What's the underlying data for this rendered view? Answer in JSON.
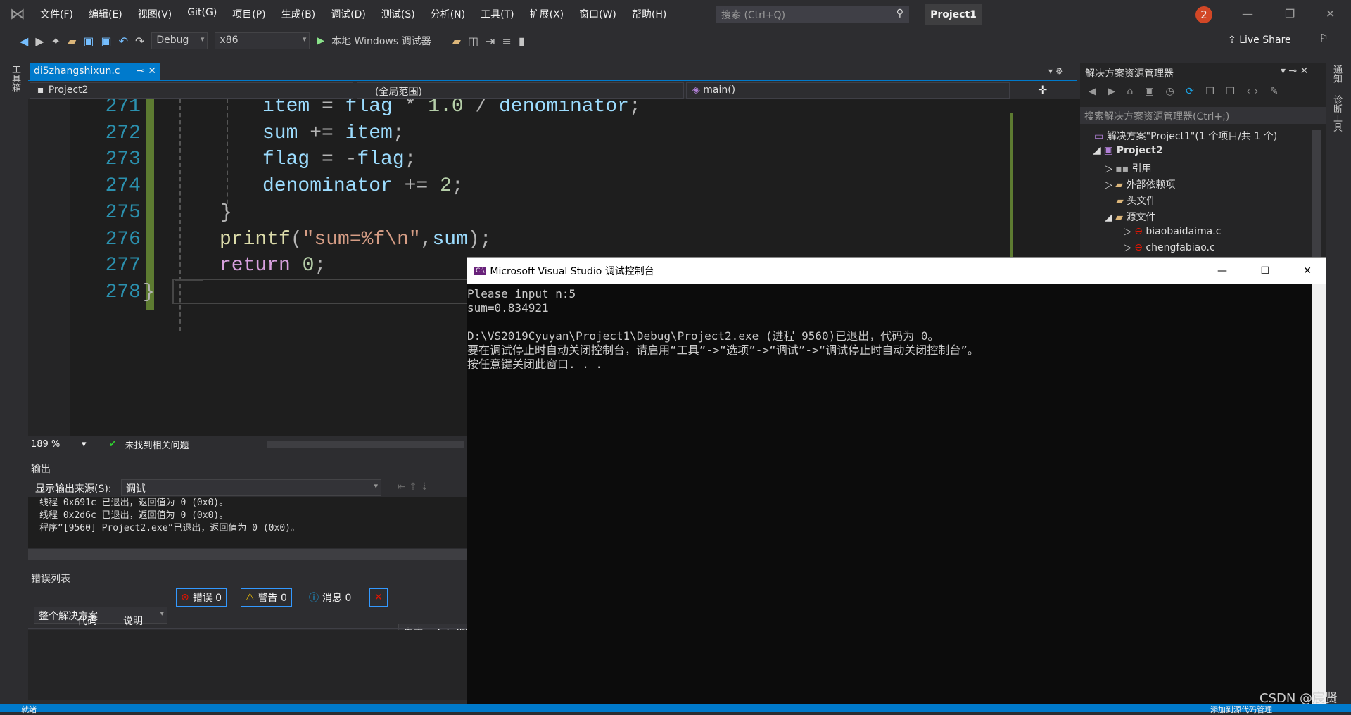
{
  "menu": {
    "items": [
      "文件(F)",
      "编辑(E)",
      "视图(V)",
      "Git(G)",
      "项目(P)",
      "生成(B)",
      "调试(D)",
      "测试(S)",
      "分析(N)",
      "工具(T)",
      "扩展(X)",
      "窗口(W)",
      "帮助(H)"
    ],
    "search_placeholder": "搜索 (Ctrl+Q)",
    "project": "Project1",
    "notifications": "2"
  },
  "toolbar": {
    "config": "Debug",
    "platform": "x86",
    "run": "本地 Windows 调试器",
    "live_share": "Live Share"
  },
  "left_strip": "工具箱",
  "right_strip": [
    "通知",
    "诊断工具"
  ],
  "editor": {
    "tab": "di5zhangshixun.c",
    "project_combo": "Project2",
    "scope_combo": "(全局范围)",
    "func_combo": "main()",
    "zoom": "189 %",
    "issues": "未找到相关问题",
    "lines": [
      {
        "n": "271",
        "tokens": [
          [
            "id",
            "item"
          ],
          [
            "op",
            " = "
          ],
          [
            "id",
            "flag"
          ],
          [
            "op",
            " * "
          ],
          [
            "num",
            "1.0"
          ],
          [
            "op",
            " / "
          ],
          [
            "id",
            "denominator"
          ],
          [
            "op",
            ";"
          ]
        ]
      },
      {
        "n": "272",
        "tokens": [
          [
            "id",
            "sum"
          ],
          [
            "op",
            " += "
          ],
          [
            "id",
            "item"
          ],
          [
            "op",
            ";"
          ]
        ]
      },
      {
        "n": "273",
        "tokens": [
          [
            "id",
            "flag"
          ],
          [
            "op",
            " = -"
          ],
          [
            "id",
            "flag"
          ],
          [
            "op",
            ";"
          ]
        ]
      },
      {
        "n": "274",
        "tokens": [
          [
            "id",
            "denominator"
          ],
          [
            "op",
            " += "
          ],
          [
            "num",
            "2"
          ],
          [
            "op",
            ";"
          ]
        ]
      },
      {
        "n": "275",
        "tokens": [
          [
            "op",
            "}"
          ]
        ]
      },
      {
        "n": "276",
        "tokens": [
          [
            "fn",
            "printf"
          ],
          [
            "op",
            "("
          ],
          [
            "str",
            "\"sum=%f\\n\""
          ],
          [
            "op",
            ","
          ],
          [
            "id",
            "sum"
          ],
          [
            "op",
            ");"
          ]
        ]
      },
      {
        "n": "277",
        "tokens": [
          [
            "kw",
            "return"
          ],
          [
            "op",
            " "
          ],
          [
            "num",
            "0"
          ],
          [
            "op",
            ";"
          ]
        ]
      },
      {
        "n": "278",
        "tokens": [
          [
            "op",
            "}"
          ]
        ]
      }
    ]
  },
  "output": {
    "title": "输出",
    "source_label": "显示输出来源(S):",
    "source": "调试",
    "lines": [
      "线程 0x691c 已退出，返回值为 0 (0x0)。",
      "线程 0x2d6c 已退出，返回值为 0 (0x0)。",
      "程序“[9560] Project2.exe”已退出，返回值为 0 (0x0)。"
    ]
  },
  "errors": {
    "title": "错误列表",
    "scope": "整个解决方案",
    "errors": "错误 0",
    "warnings": "警告 0",
    "messages": "消息 0",
    "build": "生成 + IntelliSense",
    "col_code": "代码",
    "col_desc": "说明"
  },
  "solution": {
    "title": "解决方案资源管理器",
    "search_placeholder": "搜索解决方案资源管理器(Ctrl+;)",
    "root": "解决方案\"Project1\"(1 个项目/共 1 个)",
    "project": "Project2",
    "items": [
      "引用",
      "外部依赖项",
      "头文件",
      "源文件"
    ],
    "files": [
      "biaobaidaima.c",
      "chengfabiao.c"
    ]
  },
  "console": {
    "title": "Microsoft Visual Studio 调试控制台",
    "lines": [
      "Please input n:5",
      "sum=0.834921",
      "",
      "D:\\VS2019Cyuyan\\Project1\\Debug\\Project2.exe (进程 9560)已退出，代码为 0。",
      "要在调试停止时自动关闭控制台，请启用“工具”->“选项”->“调试”->“调试停止时自动关闭控制台”。",
      "按任意键关闭此窗口. . ."
    ]
  },
  "status": {
    "left": "就绪",
    "right": "添加到源代码管理"
  },
  "watermark": "CSDN @宸贤"
}
